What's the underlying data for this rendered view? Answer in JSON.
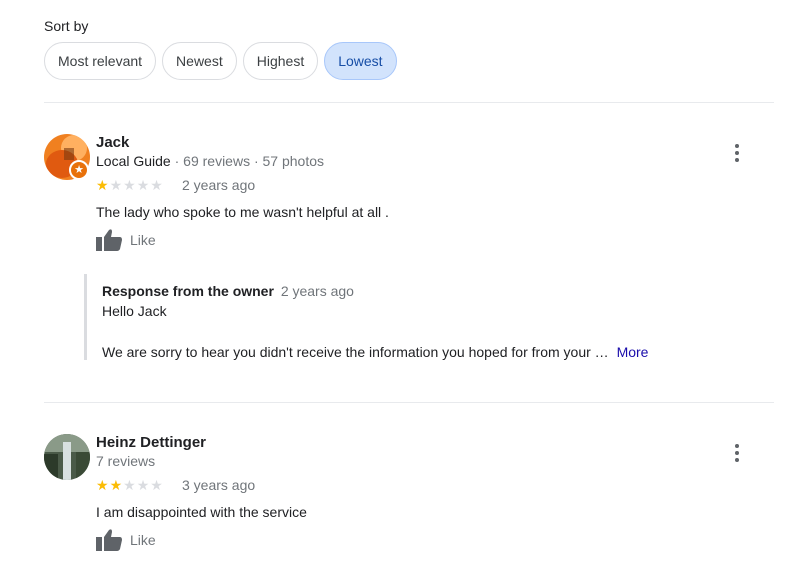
{
  "sort": {
    "label": "Sort by",
    "options": [
      "Most relevant",
      "Newest",
      "Highest",
      "Lowest"
    ],
    "selected": "Lowest"
  },
  "reviews": [
    {
      "name": "Jack",
      "local_guide": "Local Guide",
      "meta": "· 69 reviews · 57 photos",
      "rating": 1,
      "date": "2 years ago",
      "text": "The lady who spoke to me wasn't helpful at all .",
      "like_label": "Like",
      "owner_response": {
        "title": "Response from the owner",
        "date": "2 years ago",
        "greeting": "Hello Jack",
        "body": "We are sorry to hear you didn't receive the information you hoped for from your …",
        "more_label": "More"
      }
    },
    {
      "name": "Heinz Dettinger",
      "meta": "7 reviews",
      "rating": 2,
      "date": "3 years ago",
      "text": "I am disappointed with the service",
      "like_label": "Like"
    }
  ],
  "colors": {
    "star_on": "#fbbc04",
    "star_off": "#dadce0",
    "chip_selected_bg": "#d2e3fc",
    "link": "#1a0dab"
  }
}
